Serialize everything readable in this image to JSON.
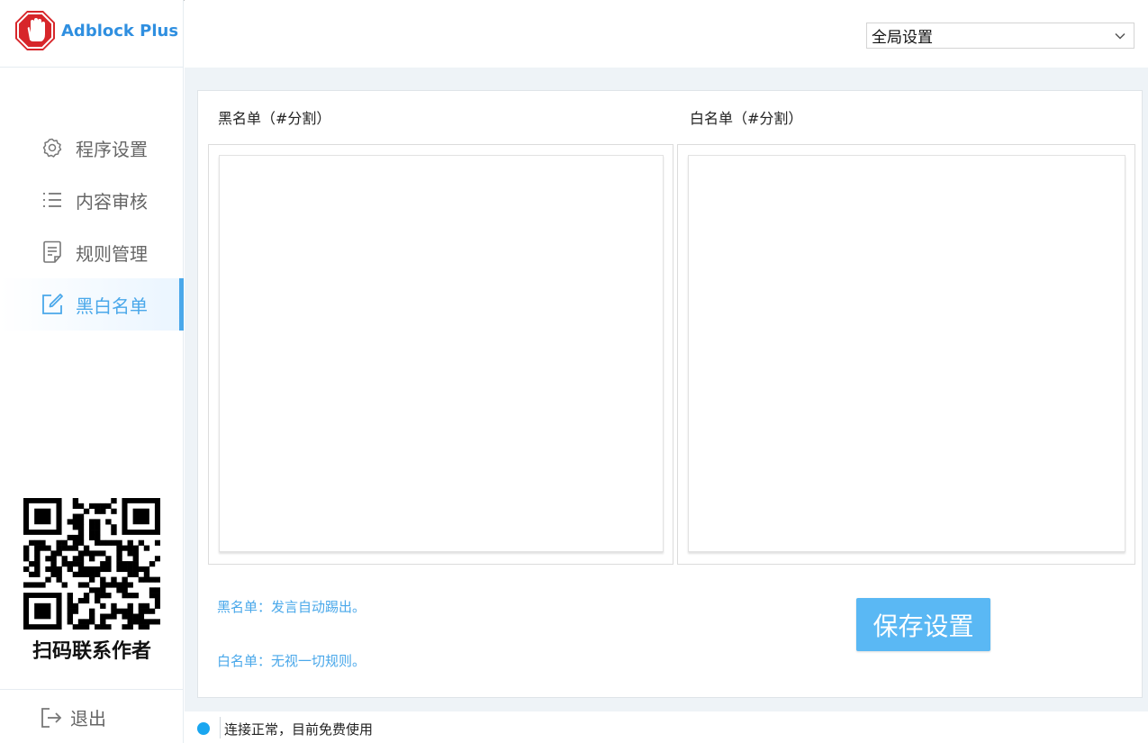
{
  "app": {
    "name": "Adblock Plus"
  },
  "colors": {
    "accent": "#4aa8ea",
    "logo_red": "#d7262a",
    "status_ok": "#1aa6f0",
    "save_bg": "#5ab8f4"
  },
  "sidebar": {
    "items": [
      {
        "label": "程序设置",
        "icon": "gear-icon"
      },
      {
        "label": "内容审核",
        "icon": "list-icon"
      },
      {
        "label": "规则管理",
        "icon": "document-icon"
      },
      {
        "label": "黑白名单",
        "icon": "edit-icon",
        "active": true
      }
    ],
    "qr_caption": "扫码联系作者",
    "logout_label": "退出"
  },
  "header": {
    "scope_select": {
      "value": "全局设置"
    }
  },
  "main": {
    "blacklist": {
      "title": "黑名单（#分割）",
      "value": ""
    },
    "whitelist": {
      "title": "白名单（#分割）",
      "value": ""
    },
    "hint_blacklist": "黑名单：发言自动踢出。",
    "hint_whitelist": "白名单：无视一切规则。",
    "save_label": "保存设置"
  },
  "status": {
    "text": "连接正常，目前免费使用"
  }
}
